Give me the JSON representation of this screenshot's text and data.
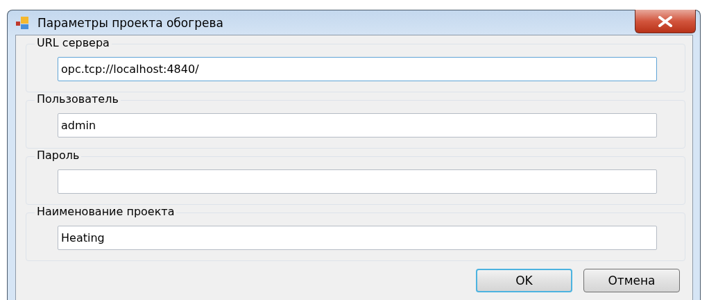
{
  "window": {
    "title": "Параметры проекта обогрева"
  },
  "groups": [
    {
      "label": "URL сервера",
      "value": "opc.tcp://localhost:4840/",
      "focused": true
    },
    {
      "label": "Пользователь",
      "value": "admin",
      "focused": false
    },
    {
      "label": "Пароль",
      "focused": false
    },
    {
      "label": "Наименование проекта",
      "value": "Heating",
      "focused": false
    }
  ],
  "buttons": [
    {
      "label": "OK",
      "default": true
    },
    {
      "label": "Отмена",
      "default": false
    }
  ]
}
